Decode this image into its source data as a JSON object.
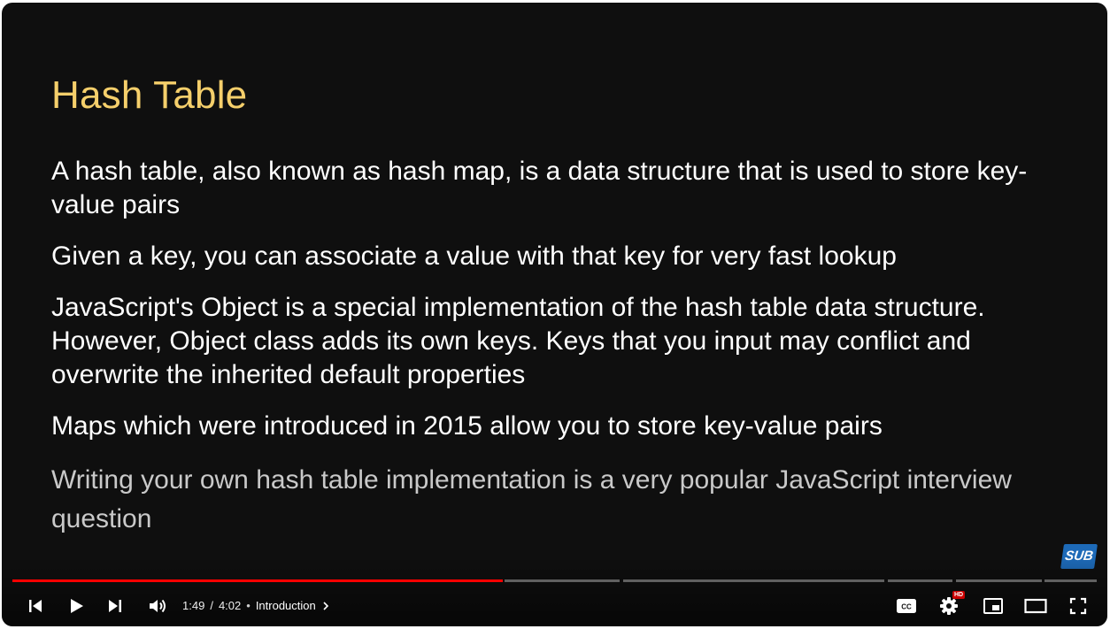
{
  "slide": {
    "title": "Hash Table",
    "bullets": [
      "A hash table, also known as hash map, is a data structure that is used to store key-value pairs",
      "Given a key, you can associate a value with that key for very fast lookup",
      "JavaScript's Object is a special implementation of the hash table data structure. However, Object class adds its own keys. Keys that you input may conflict and overwrite the inherited default properties",
      "Maps which were introduced in 2015 allow you to store key-value pairs",
      "Writing your own hash table implementation is a very popular JavaScript interview question"
    ]
  },
  "overlay": {
    "subscribe_badge": "SUB"
  },
  "player": {
    "progress_fraction": 0.452,
    "current_time": "1:49",
    "duration": "4:02",
    "time_separator": "/",
    "chapter_bullet": "•",
    "chapter_title": "Introduction",
    "hd_badge": "HD",
    "colors": {
      "played": "#ff0000",
      "title": "#f5cf6b"
    },
    "icons": [
      "previous-icon",
      "play-icon",
      "next-icon",
      "volume-icon",
      "chevron-right-icon",
      "captions-icon",
      "settings-gear-icon",
      "miniplayer-icon",
      "theater-mode-icon",
      "fullscreen-icon"
    ]
  }
}
